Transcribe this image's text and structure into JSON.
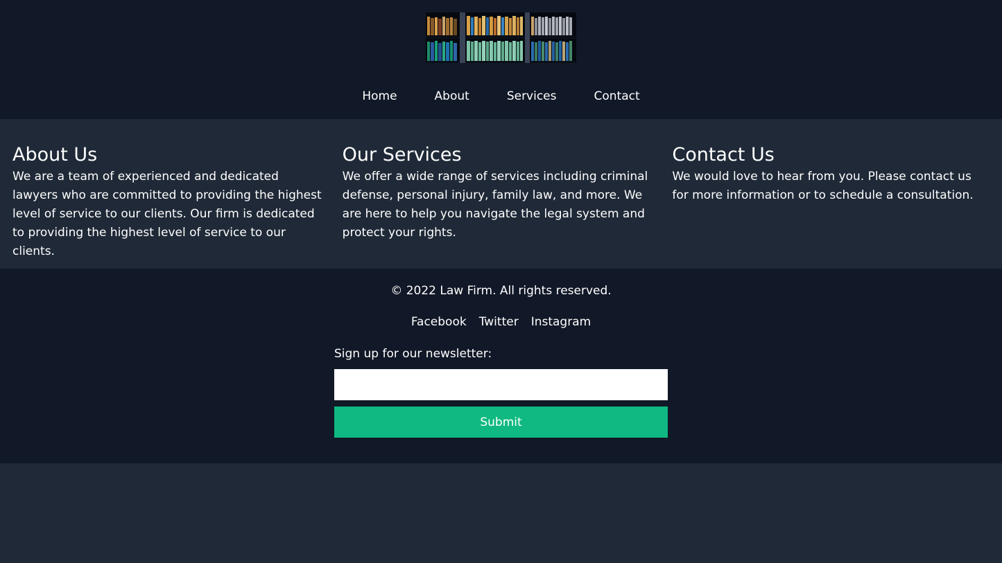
{
  "logo": {
    "alt": "Law library bookshelf logo"
  },
  "nav": {
    "items": [
      "Home",
      "About",
      "Services",
      "Contact"
    ]
  },
  "sections": [
    {
      "title": "About Us",
      "body": "We are a team of experienced and dedicated lawyers who are committed to providing the highest level of service to our clients. Our firm is dedicated to providing the highest level of service to our clients."
    },
    {
      "title": "Our Services",
      "body": "We offer a wide range of services including criminal defense, personal injury, family law, and more. We are here to help you navigate the legal system and protect your rights."
    },
    {
      "title": "Contact Us",
      "body": "We would love to hear from you. Please contact us for more information or to schedule a consultation."
    }
  ],
  "footer": {
    "copyright": "© 2022 Law Firm. All rights reserved.",
    "social": [
      "Facebook",
      "Twitter",
      "Instagram"
    ],
    "newsletter": {
      "label": "Sign up for our newsletter:",
      "value": "",
      "submit": "Submit"
    }
  },
  "colors": {
    "header_bg": "#111827",
    "main_bg": "#1f2937",
    "accent": "#10b981"
  }
}
